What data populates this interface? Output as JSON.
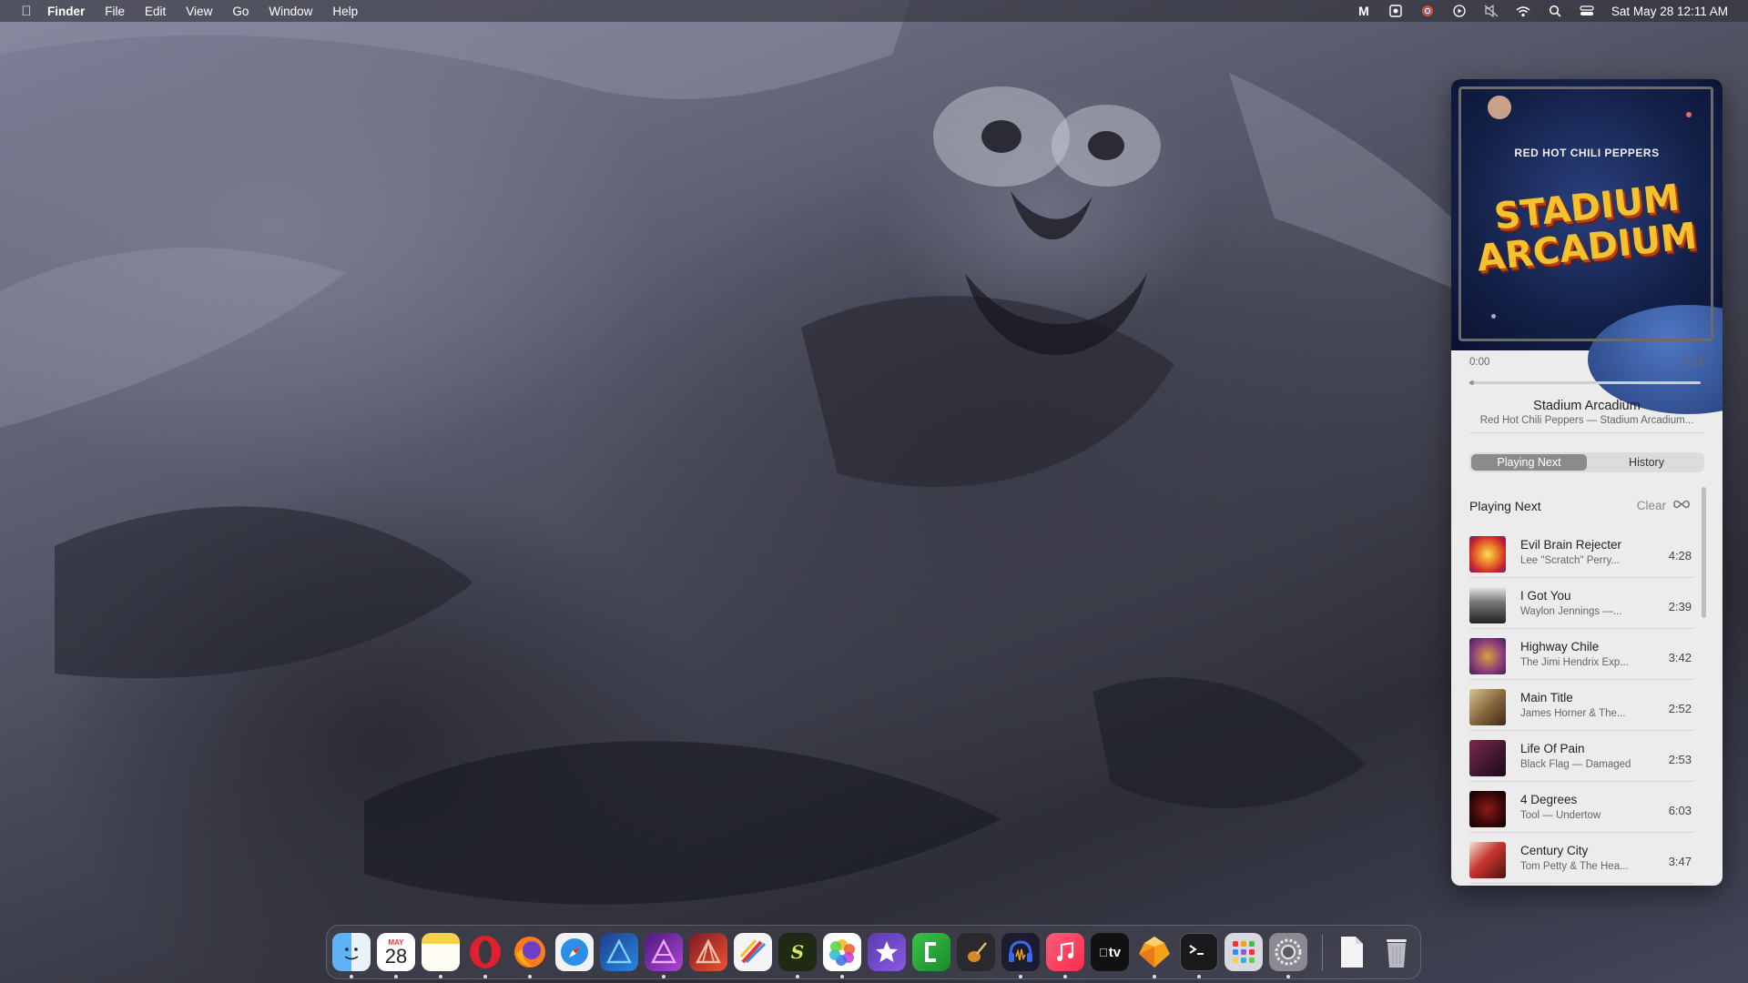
{
  "menubar": {
    "apple": "",
    "items": [
      "Finder",
      "File",
      "Edit",
      "View",
      "Go",
      "Window",
      "Help"
    ],
    "status_icons": [
      "mastodon-icon",
      "dashboard-icon",
      "chrome-icon",
      "play-icon",
      "mute-icon",
      "wifi-icon",
      "search-icon",
      "control-center-icon"
    ],
    "clock": "Sat May 28  12:11 AM"
  },
  "player": {
    "album_art": {
      "band": "RED HOT CHILI PEPPERS",
      "title_line1": "STADIUM",
      "title_line2": "ARCADIUM"
    },
    "elapsed": "0:00",
    "remaining": "-5:16",
    "progress": 0.01,
    "track_title": "Stadium Arcadium",
    "track_subtitle": "Red Hot Chili Peppers — Stadium Arcadium...",
    "tabs": [
      "Playing Next",
      "History"
    ],
    "active_tab": "Playing Next"
  },
  "queue": {
    "header": "Playing Next",
    "clear_label": "Clear",
    "items": [
      {
        "title": "Evil Brain Rejecter",
        "subtitle": "Lee \"Scratch\" Perry...",
        "duration": "4:28"
      },
      {
        "title": "I Got You",
        "subtitle": "Waylon Jennings —...",
        "duration": "2:39"
      },
      {
        "title": "Highway Chile",
        "subtitle": "The Jimi Hendrix Exp...",
        "duration": "3:42"
      },
      {
        "title": "Main Title",
        "subtitle": "James Horner & The...",
        "duration": "2:52"
      },
      {
        "title": "Life Of Pain",
        "subtitle": "Black Flag — Damaged",
        "duration": "2:53"
      },
      {
        "title": "4 Degrees",
        "subtitle": "Tool — Undertow",
        "duration": "6:03"
      },
      {
        "title": "Century City",
        "subtitle": "Tom Petty & The Hea...",
        "duration": "3:47"
      }
    ]
  },
  "dock": {
    "calendar_day": "28",
    "calendar_month": "MAY",
    "tv_label": "tv",
    "apps": [
      "Finder",
      "Calendar",
      "Notes",
      "Opera",
      "Firefox",
      "Safari",
      "Affinity Designer",
      "Affinity Photo",
      "Affinity Publisher",
      "Pixelmator",
      "Scrivener",
      "Photos",
      "iMovie",
      "Coda",
      "GarageBand",
      "Audio",
      "Music",
      "TV",
      "Sketch",
      "Terminal",
      "Launchpad",
      "System Preferences",
      "Documents",
      "Trash"
    ]
  }
}
